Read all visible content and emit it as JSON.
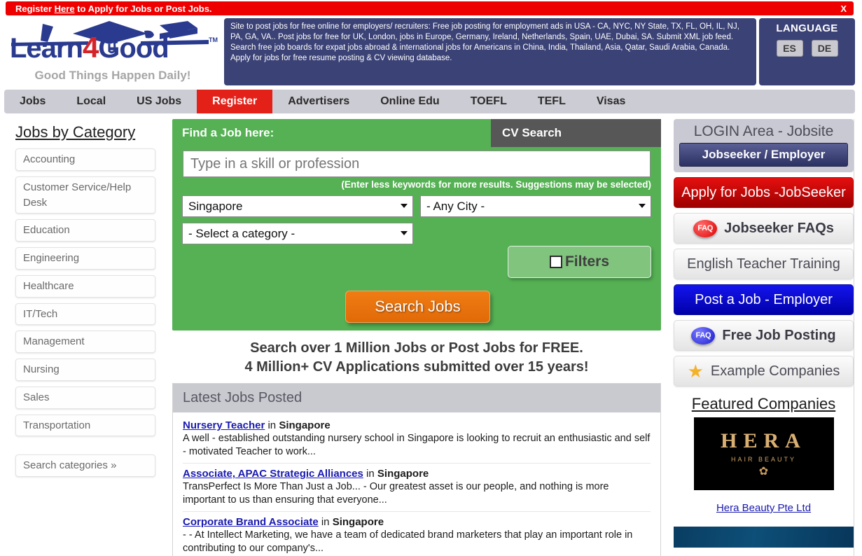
{
  "notice": {
    "text_before": "Register ",
    "link": "Here",
    "text_after": " to Apply for Jobs or Post Jobs.",
    "close": "X"
  },
  "logo": {
    "word1": "Learn",
    "four": "4",
    "word2": "Good",
    "tm": "TM",
    "tagline": "Good Things Happen Daily!"
  },
  "header": {
    "description": "Site to post jobs for free online for employers/ recruiters: Free job posting for employment ads in USA - CA, NYC, NY State, TX, FL, OH, IL, NJ, PA, GA, VA.. Post jobs for free for UK, London, jobs in Europe, Germany, Ireland, Netherlands, Spain, UAE, Dubai, SA. Submit XML job feed. Search free job boards for expat jobs abroad & international jobs for Americans in China, India, Thailand, Asia, Qatar, Saudi Arabia, Canada. Apply for jobs for free resume posting & CV viewing database.",
    "language_label": "LANGUAGE",
    "lang_es": "ES",
    "lang_de": "DE"
  },
  "nav": {
    "items": [
      {
        "label": "Jobs",
        "active": false
      },
      {
        "label": "Local",
        "active": false
      },
      {
        "label": "US Jobs",
        "active": false
      },
      {
        "label": "Register",
        "active": true
      },
      {
        "label": "Advertisers",
        "active": false
      },
      {
        "label": "Online Edu",
        "active": false
      },
      {
        "label": "TOEFL",
        "active": false
      },
      {
        "label": "TEFL",
        "active": false
      },
      {
        "label": "Visas",
        "active": false
      }
    ]
  },
  "sidebar": {
    "title": "Jobs by Category",
    "categories": [
      "Accounting",
      "Customer Service/Help Desk",
      "Education",
      "Engineering",
      "Healthcare",
      "IT/Tech",
      "Management",
      "Nursing",
      "Sales",
      "Transportation"
    ],
    "search_categories": "Search categories »"
  },
  "search_panel": {
    "title": "Find a Job here:",
    "cv_search_tab": "CV Search",
    "skill_placeholder": "Type in a skill or profession",
    "skill_value": "",
    "hint": "(Enter less keywords for more results. Suggestions may be selected)",
    "country_selected": "Singapore",
    "city_selected": "- Any City -",
    "category_selected": "- Select a category -",
    "filters_label": "Filters",
    "filters_checked": false,
    "search_button": "Search Jobs"
  },
  "promo": {
    "line1": "Search over 1 Million Jobs or Post Jobs for FREE.",
    "line2": "4 Million+ CV Applications submitted over 15 years!"
  },
  "latest_jobs": {
    "header": "Latest Jobs Posted",
    "in_word": "in",
    "items": [
      {
        "title": "Nursery Teacher",
        "location": "Singapore",
        "description": "A well - established outstanding nursery school in Singapore is looking to recruit an enthusiastic and self - motivated Teacher to work..."
      },
      {
        "title": "Associate, APAC Strategic Alliances",
        "location": "Singapore",
        "description": "TransPerfect Is More Than Just a Job... - Our greatest asset is our people, and nothing is more important to us than ensuring that everyone..."
      },
      {
        "title": "Corporate Brand Associate",
        "location": "Singapore",
        "description": "- - At Intellect Marketing, we have a team of dedicated brand marketers that play an important role in contributing to our company's..."
      }
    ]
  },
  "right_panel": {
    "login_title": "LOGIN Area - Jobsite",
    "login_button": "Jobseeker / Employer",
    "apply_jobs": "Apply for Jobs -JobSeeker",
    "jobseeker_faqs": "Jobseeker FAQs",
    "faq_badge": "FAQ",
    "english_teacher_training": "English Teacher Training",
    "post_a_job": "Post a Job - Employer",
    "free_job_posting": "Free Job Posting",
    "example_companies": "Example Companies",
    "featured_title": "Featured Companies",
    "featured_company": {
      "logo_name": "HERA",
      "logo_sub": "HAIR BEAUTY",
      "link": "Hera Beauty Pte Ltd"
    }
  },
  "colors": {
    "notice_red": "#ee0000",
    "header_blue": "#3b4276",
    "nav_grey": "#ccccd4",
    "nav_active_red": "#e32119",
    "panel_green": "#55b154",
    "cv_tab_grey": "#575757",
    "search_orange": "#e87c14",
    "link_blue": "#1a1ab0",
    "latest_header_grey": "#c9c9d0"
  }
}
